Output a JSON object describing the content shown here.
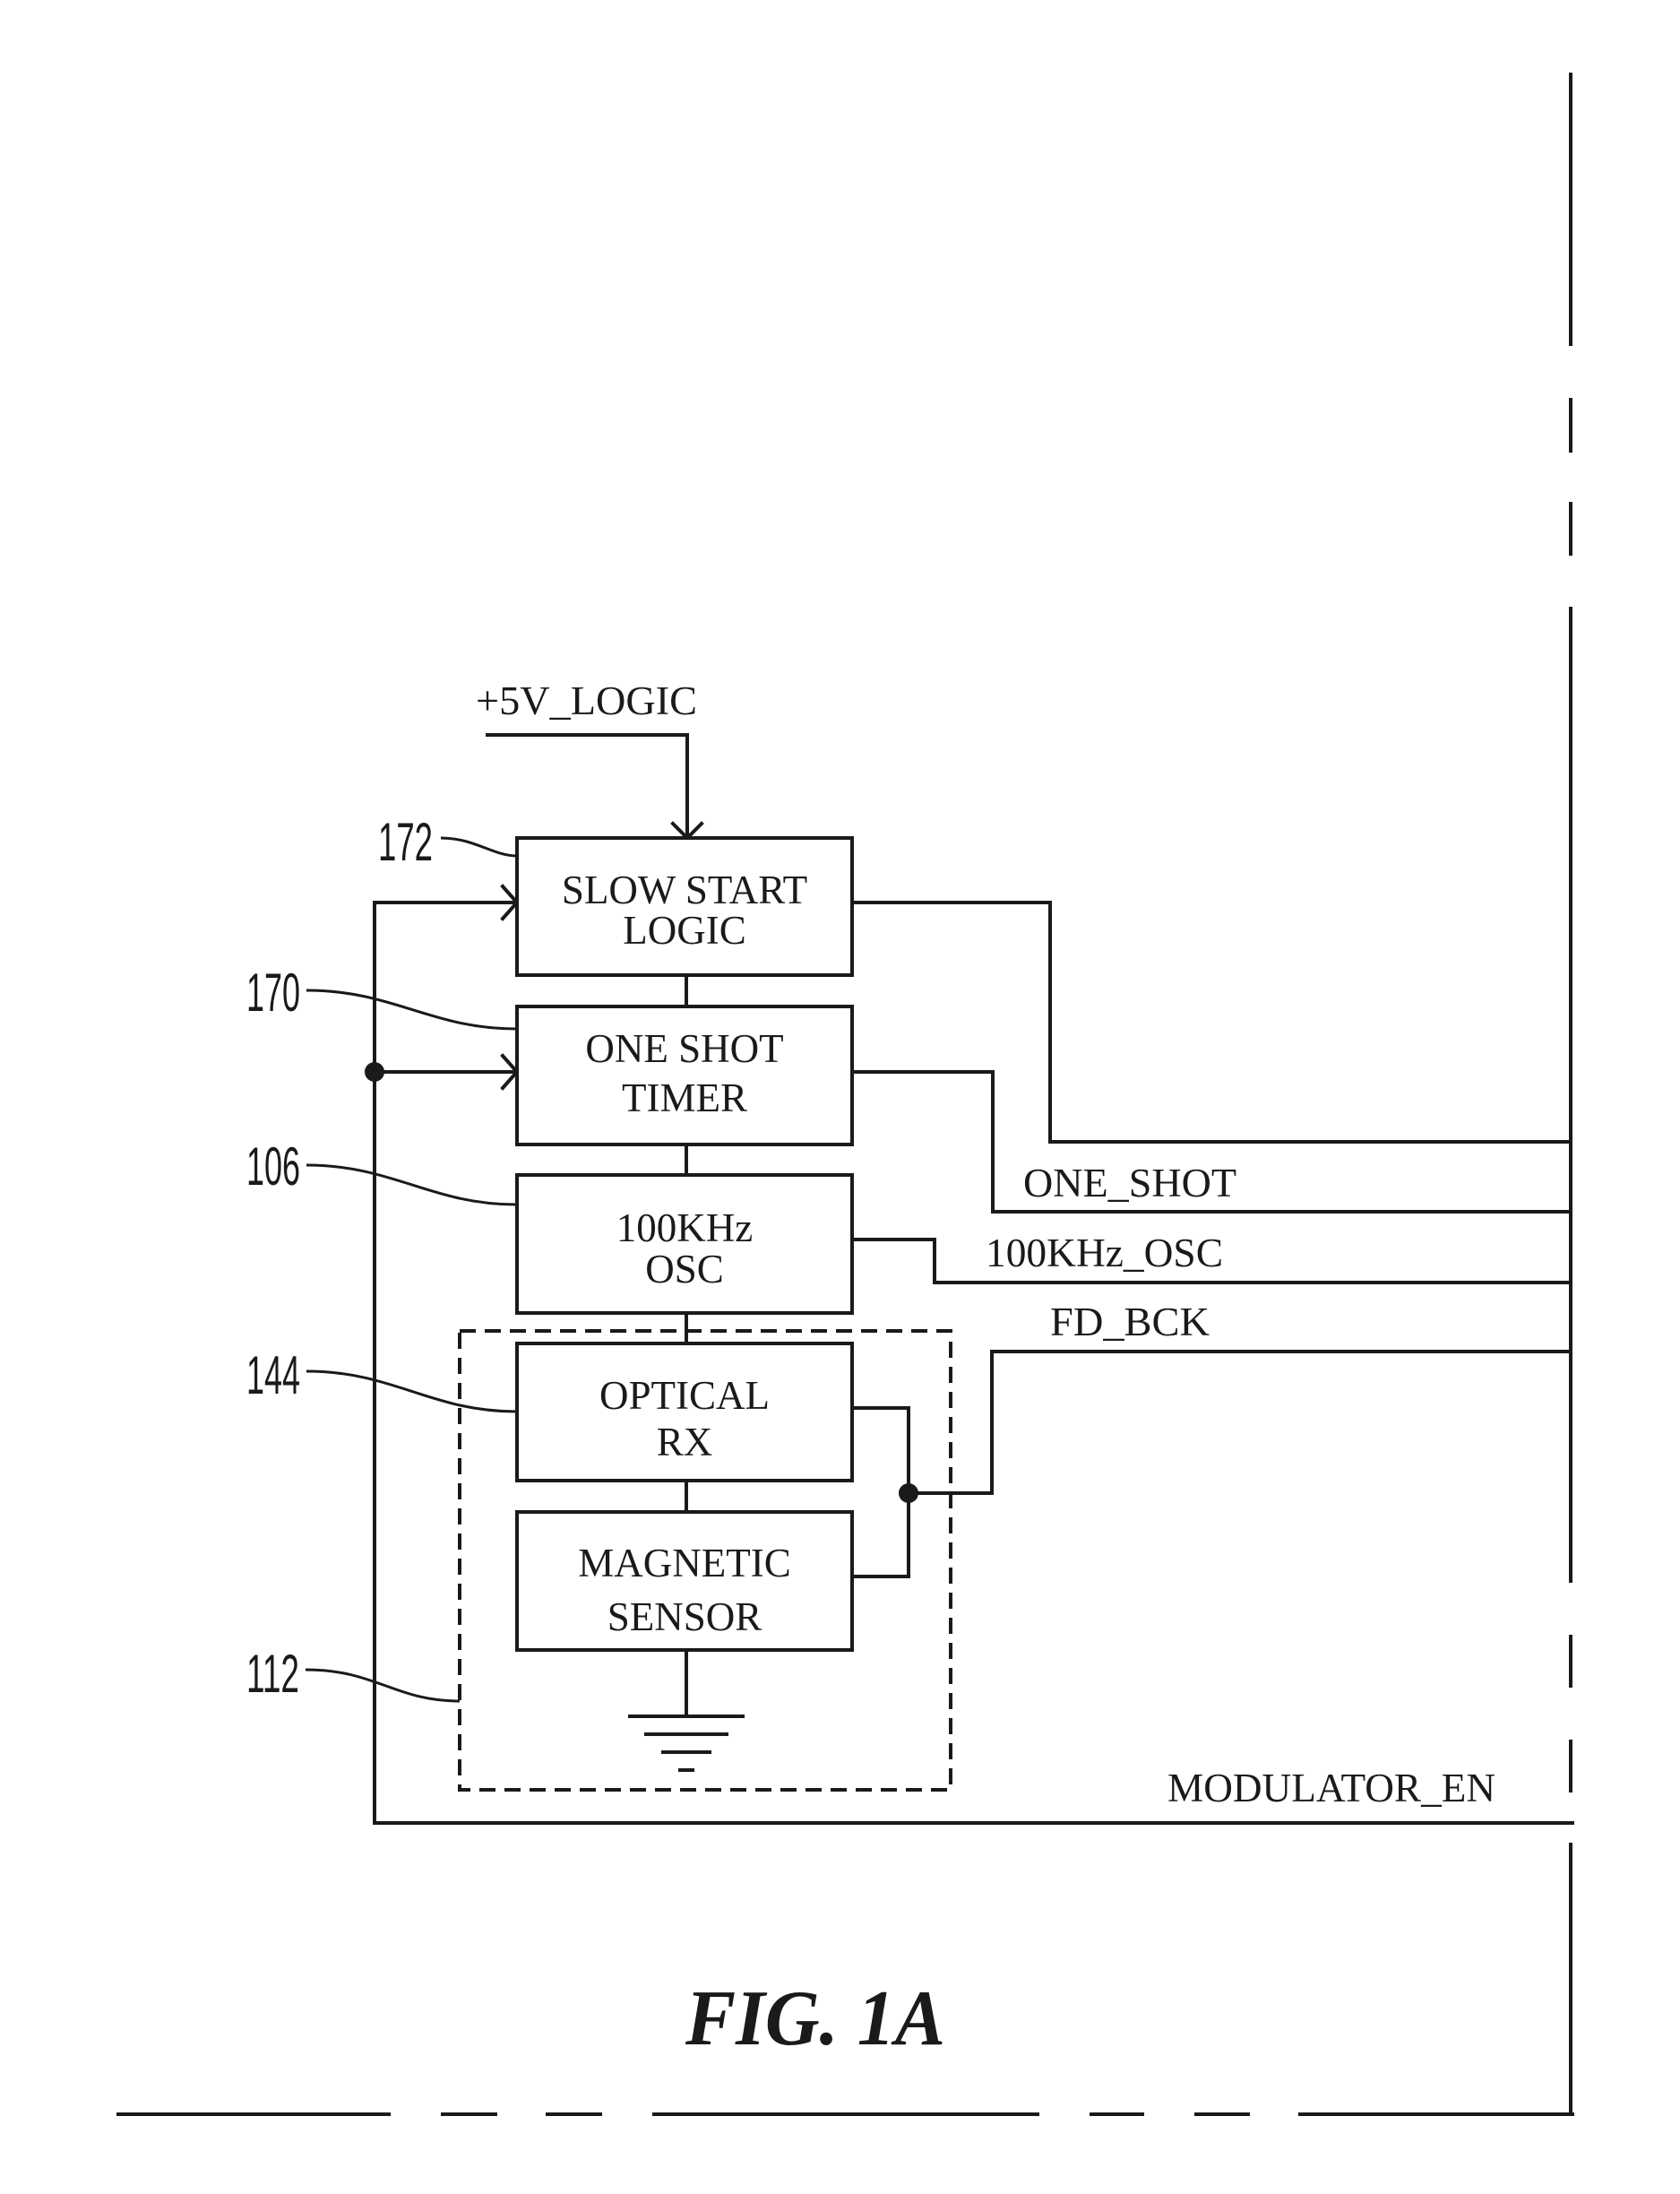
{
  "figure": {
    "caption": "FIG. 1A",
    "power_input": "+5V_LOGIC",
    "blocks": [
      {
        "id": "172",
        "lines": [
          "SLOW START",
          "LOGIC"
        ]
      },
      {
        "id": "170",
        "lines": [
          "ONE SHOT",
          "TIMER"
        ]
      },
      {
        "id": "106",
        "lines": [
          "100KHz",
          "OSC"
        ]
      },
      {
        "id": "144",
        "lines": [
          "OPTICAL",
          "RX"
        ]
      },
      {
        "id": "",
        "lines": [
          "MAGNETIC",
          "SENSOR"
        ]
      }
    ],
    "reference_numerals": [
      "172",
      "170",
      "106",
      "144",
      "112"
    ],
    "signals": {
      "one_shot": "ONE_SHOT",
      "osc": "100KHz_OSC",
      "fd_bck": "FD_BCK",
      "modulator_en": "MODULATOR_EN"
    },
    "ground_symbol": "ground-icon",
    "colors": {
      "ink": "#1a1a1a",
      "background": "#ffffff"
    }
  }
}
